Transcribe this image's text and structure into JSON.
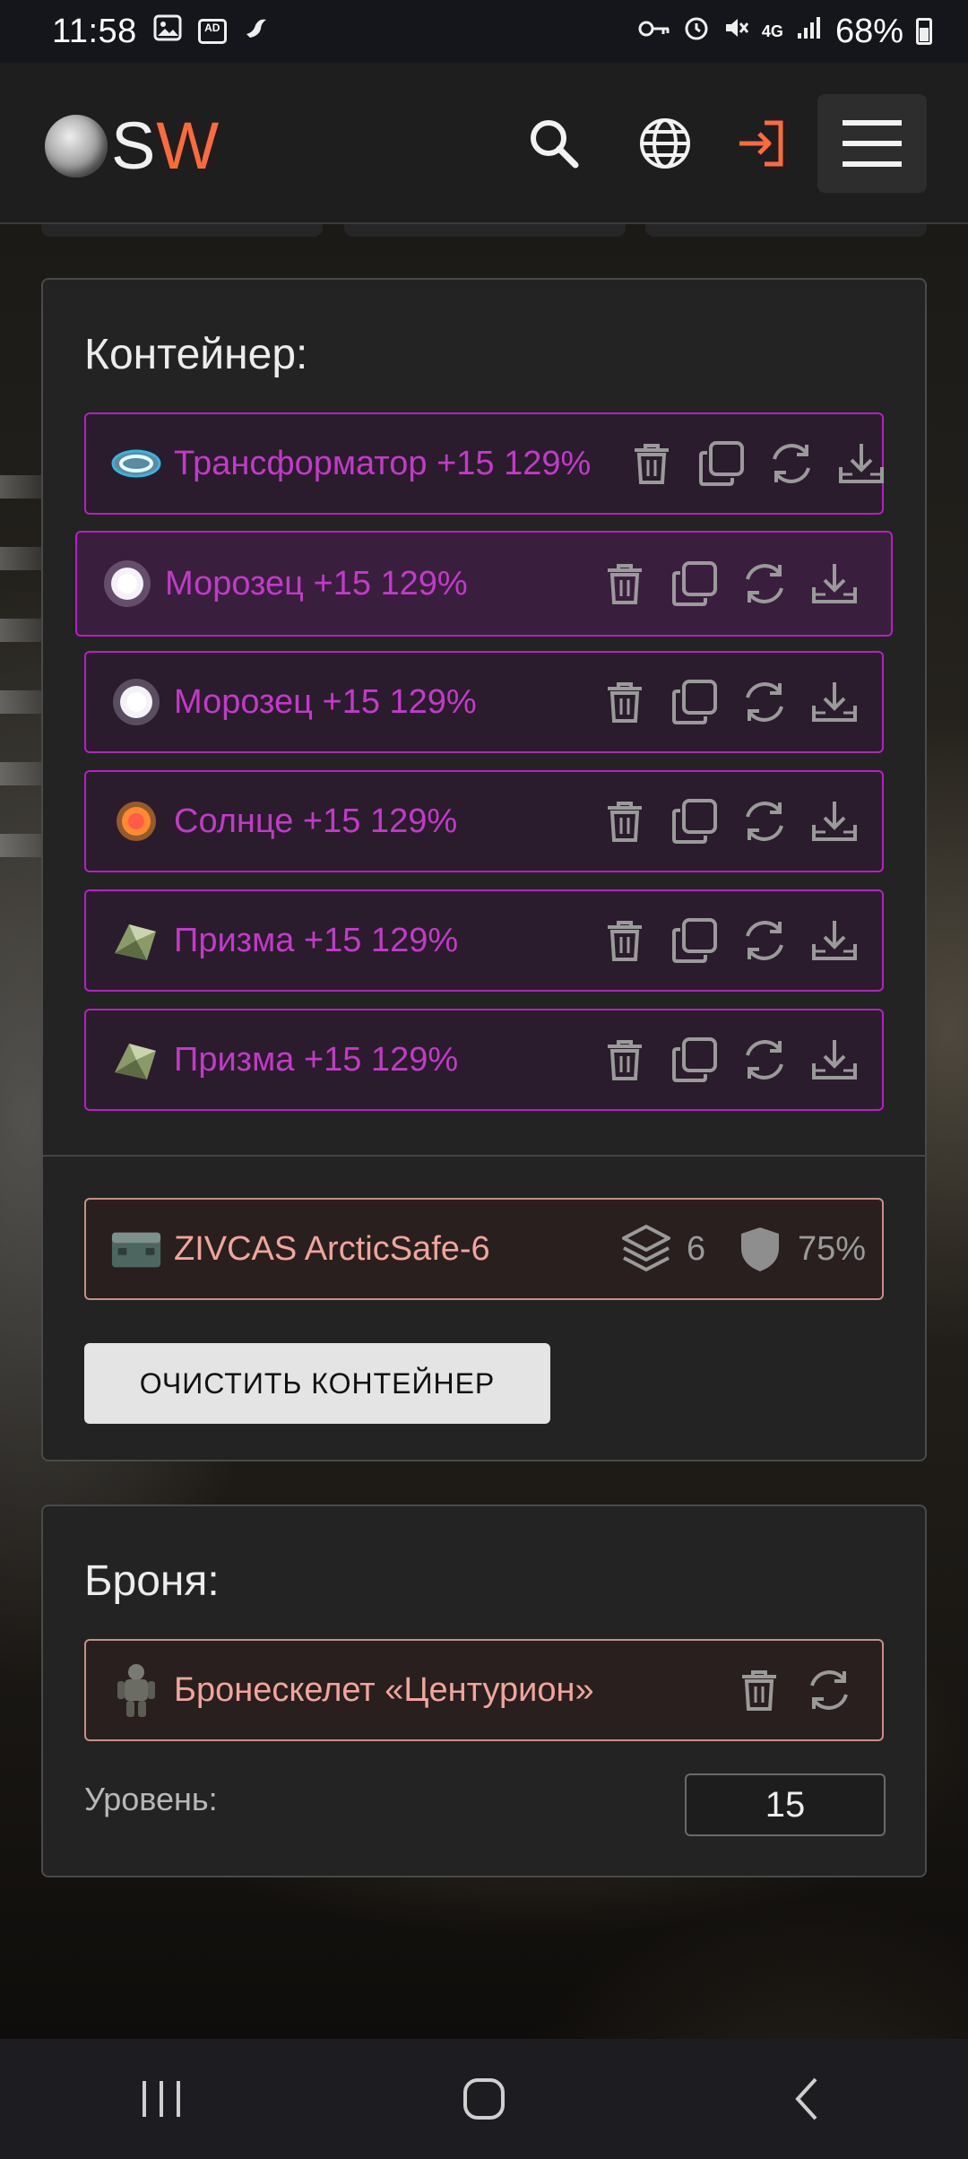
{
  "status_bar": {
    "time": "11:58",
    "battery": "68%",
    "network": "4G",
    "left_icons": [
      "gallery-icon",
      "adblocker-icon",
      "bird-icon"
    ],
    "right_icons": [
      "key-icon",
      "alarm-icon",
      "mute-icon",
      "network-4g-icon",
      "signal-icon",
      "battery-icon"
    ]
  },
  "header": {
    "logo_s": "S",
    "logo_w": "W",
    "accent_color": "#ff6a3d"
  },
  "container_card": {
    "title": "Контейнер:",
    "items": [
      {
        "name": "Трансформатор +15 129%",
        "icon": "transformer-artifact-icon"
      },
      {
        "name": "Морозец +15 129%",
        "icon": "frost-artifact-icon"
      },
      {
        "name": "Морозец +15 129%",
        "icon": "frost-artifact-icon"
      },
      {
        "name": "Солнце +15 129%",
        "icon": "sun-artifact-icon"
      },
      {
        "name": "Призма +15 129%",
        "icon": "prism-artifact-icon"
      },
      {
        "name": "Призма +15 129%",
        "icon": "prism-artifact-icon"
      }
    ],
    "container_item": {
      "name": "ZIVCAS ArcticSafe-6",
      "slots": "6",
      "protection": "75%"
    },
    "clear_button": "ОЧИСТИТЬ КОНТЕЙНЕР",
    "item_color": "#c23ac8"
  },
  "armor_card": {
    "title": "Броня:",
    "armor_name": "Бронескелет «Центурион»",
    "level_label": "Уровень:",
    "level_value": "15"
  }
}
